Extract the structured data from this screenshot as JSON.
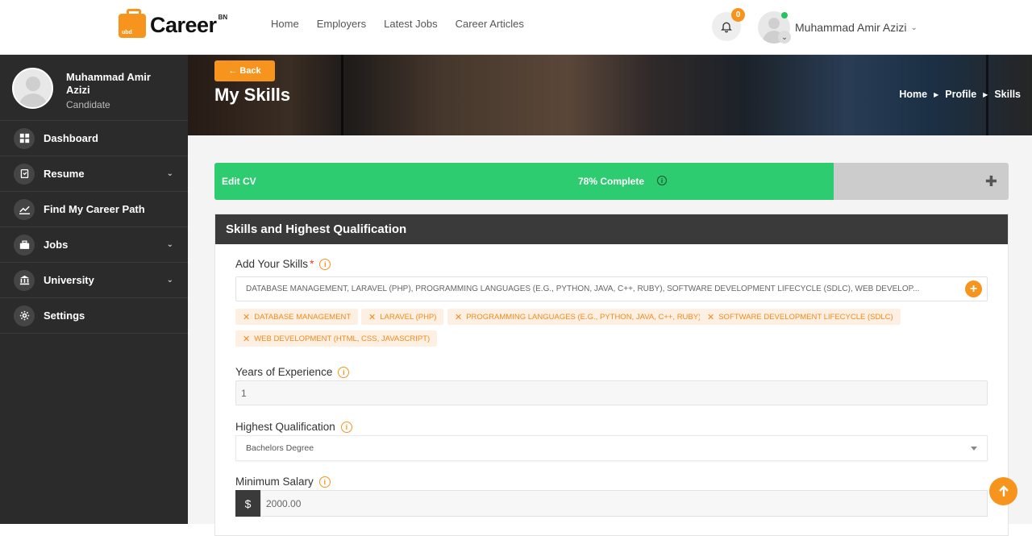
{
  "brand": {
    "name": "Career",
    "sup": "BN",
    "badge": "ubd"
  },
  "nav": {
    "links": [
      "Home",
      "Employers",
      "Latest Jobs",
      "Career Articles"
    ]
  },
  "notifications": {
    "count": "0"
  },
  "user": {
    "name": "Muhammad Amir Azizi",
    "role": "Candidate"
  },
  "sidebar": {
    "items": [
      {
        "label": "Dashboard",
        "icon": "dashboard-icon",
        "has_submenu": false
      },
      {
        "label": "Resume",
        "icon": "resume-icon",
        "has_submenu": true
      },
      {
        "label": "Find My Career Path",
        "icon": "chart-line-icon",
        "has_submenu": false
      },
      {
        "label": "Jobs",
        "icon": "briefcase-icon",
        "has_submenu": true
      },
      {
        "label": "University",
        "icon": "university-icon",
        "has_submenu": true
      },
      {
        "label": "Settings",
        "icon": "gear-icon",
        "has_submenu": false
      }
    ]
  },
  "hero": {
    "back_label": "Back",
    "title": "My Skills",
    "breadcrumb": [
      "Home",
      "Profile",
      "Skills"
    ]
  },
  "progress": {
    "label": "Edit CV",
    "percent": 78,
    "text": "78% Complete"
  },
  "card": {
    "title": "Skills and Highest Qualification",
    "skills": {
      "label": "Add Your Skills",
      "value": "DATABASE MANAGEMENT, LARAVEL (PHP), PROGRAMMING LANGUAGES (E.G., PYTHON, JAVA, C++, RUBY), SOFTWARE DEVELOPMENT LIFECYCLE (SDLC), WEB DEVELOP...",
      "tags": [
        "DATABASE MANAGEMENT",
        "LARAVEL (PHP)",
        "PROGRAMMING LANGUAGES (E.G., PYTHON, JAVA, C++, RUBY)",
        "SOFTWARE DEVELOPMENT LIFECYCLE (SDLC)",
        "WEB DEVELOPMENT (HTML, CSS, JAVASCRIPT)"
      ]
    },
    "experience": {
      "label": "Years of Experience",
      "value": "1"
    },
    "qualification": {
      "label": "Highest Qualification",
      "value": "Bachelors Degree"
    },
    "salary": {
      "label": "Minimum Salary",
      "currency": "$",
      "value": "2000.00"
    }
  },
  "colors": {
    "accent": "#f7941d",
    "progress": "#2ecc71",
    "sidebar": "#2b2b2b"
  }
}
